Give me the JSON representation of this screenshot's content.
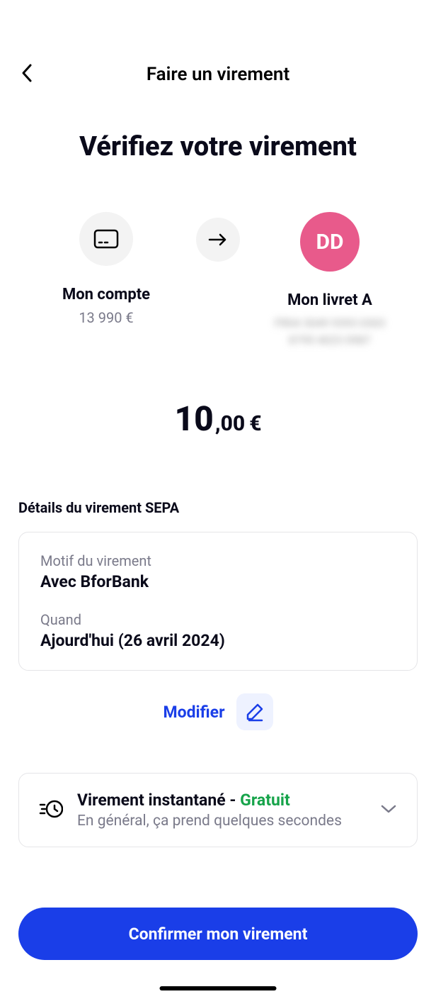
{
  "header": {
    "title": "Faire un virement"
  },
  "page_title": "Vérifiez votre virement",
  "from_account": {
    "name": "Mon compte",
    "balance": "13 990 €"
  },
  "to_account": {
    "initials": "DD",
    "name": "Mon livret A",
    "masked_line1": "FR04 3049 9393 0303",
    "masked_line2": "8795 4023 0987"
  },
  "amount": {
    "whole": "10",
    "decimal": ",00",
    "currency": "€"
  },
  "details": {
    "section_label": "Détails du virement SEPA",
    "motif_label": "Motif du virement",
    "motif_value": "Avec BforBank",
    "when_label": "Quand",
    "when_value": "Ajourd'hui (26 avril 2024)"
  },
  "modify": {
    "label": "Modifier"
  },
  "instant": {
    "title_prefix": "Virement instantané - ",
    "title_free": "Gratuit",
    "subtitle": "En général, ça prend quelques secondes"
  },
  "confirm_button": "Confirmer mon virement"
}
